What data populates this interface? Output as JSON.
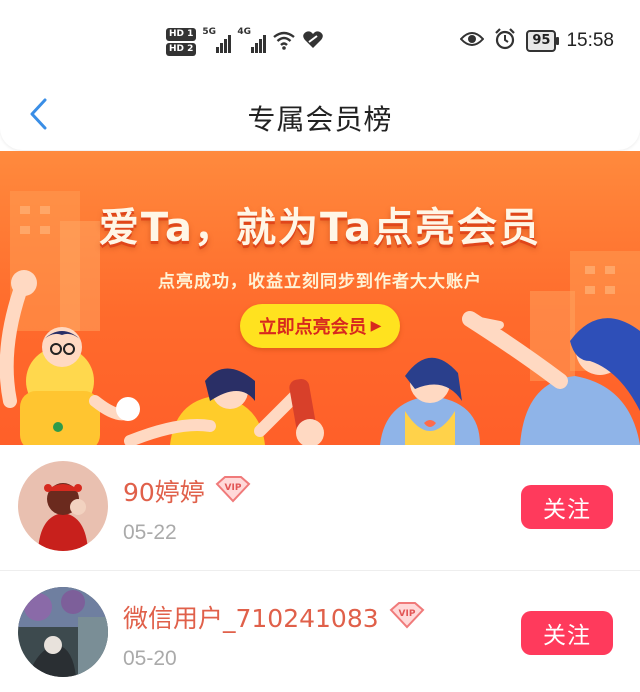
{
  "status_bar": {
    "hd1": "HD 1",
    "hd2": "HD 2",
    "net1": "5G",
    "net2": "4G",
    "battery": "95",
    "time": "15:58"
  },
  "header": {
    "back_icon": "chevron-left-icon",
    "title": "专属会员榜",
    "accent": "#3a8ee6"
  },
  "banner": {
    "headline": "爱Ta，就为Ta点亮会员",
    "subtitle": "点亮成功，收益立刻同步到作者大大账户",
    "cta_label": "立即点亮会员",
    "cta_arrow": "▶",
    "bg_color": "#ff6b2c",
    "cta_color": "#ffe21f"
  },
  "members": [
    {
      "name": "90婷婷",
      "vip_label": "VIP",
      "date": "05-22",
      "follow_label": "关注"
    },
    {
      "name": "微信用户_710241083",
      "vip_label": "VIP",
      "date": "05-20",
      "follow_label": "关注"
    }
  ],
  "colors": {
    "follow_button": "#ff3a5c",
    "name_text": "#e0604a",
    "date_text": "#aaaaaa"
  }
}
